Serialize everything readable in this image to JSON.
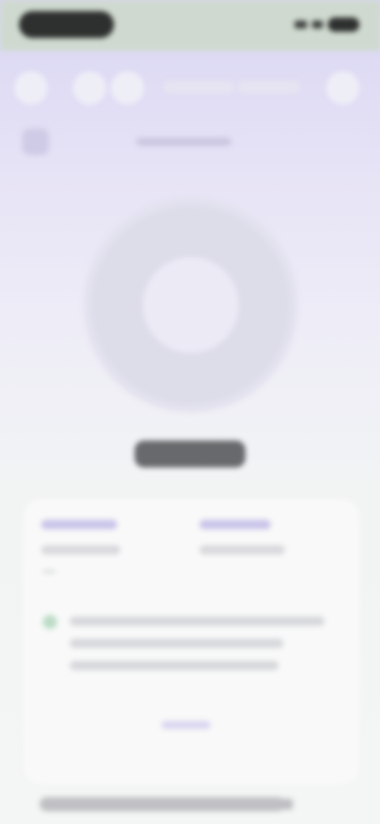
{
  "screen": {
    "title": "",
    "status_label": "",
    "card": {
      "left_label": "",
      "left_value": "",
      "right_label": "",
      "right_value": "",
      "description": "",
      "link_label": ""
    },
    "footer_text": ""
  },
  "icons": {
    "back": "chevron-left-icon",
    "signal": "signal-icon",
    "wifi": "wifi-icon",
    "battery": "battery-icon",
    "info": "info-dot-icon",
    "footer_chevron": "chevron-right-icon"
  },
  "colors": {
    "header_gradient_top": "#d9d6f3",
    "status_bar": "#cfd9cf",
    "donut_ring": "#dddce9",
    "donut_center": "#eceaf5",
    "card_bg": "#f8f9f8",
    "accent_lavender": "#c9c4ea",
    "info_dot": "#bcdcc7"
  }
}
